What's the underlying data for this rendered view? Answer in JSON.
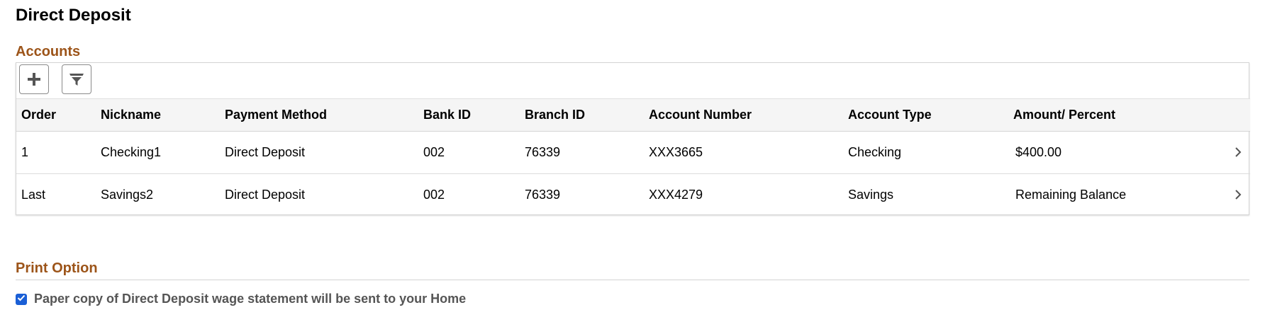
{
  "page": {
    "title": "Direct Deposit"
  },
  "colors": {
    "section_title": "#9c5419",
    "checkbox": "#1a5fd6"
  },
  "accounts": {
    "title": "Accounts",
    "toolbar": {
      "add_icon": "plus-icon",
      "filter_icon": "filter-icon"
    },
    "columns": [
      "Order",
      "Nickname",
      "Payment Method",
      "Bank ID",
      "Branch ID",
      "Account Number",
      "Account Type",
      "Amount/ Percent"
    ],
    "rows": [
      [
        "1",
        "Checking1",
        "Direct Deposit",
        "002",
        "76339",
        "XXX3665",
        "Checking",
        "$400.00"
      ],
      [
        "Last",
        "Savings2",
        "Direct Deposit",
        "002",
        "76339",
        "XXX4279",
        "Savings",
        "Remaining Balance"
      ]
    ],
    "row_icon": "chevron-right-icon"
  },
  "print_option": {
    "title": "Print Option",
    "checked": true,
    "label": "Paper copy of Direct Deposit wage statement will be sent to your Home"
  }
}
